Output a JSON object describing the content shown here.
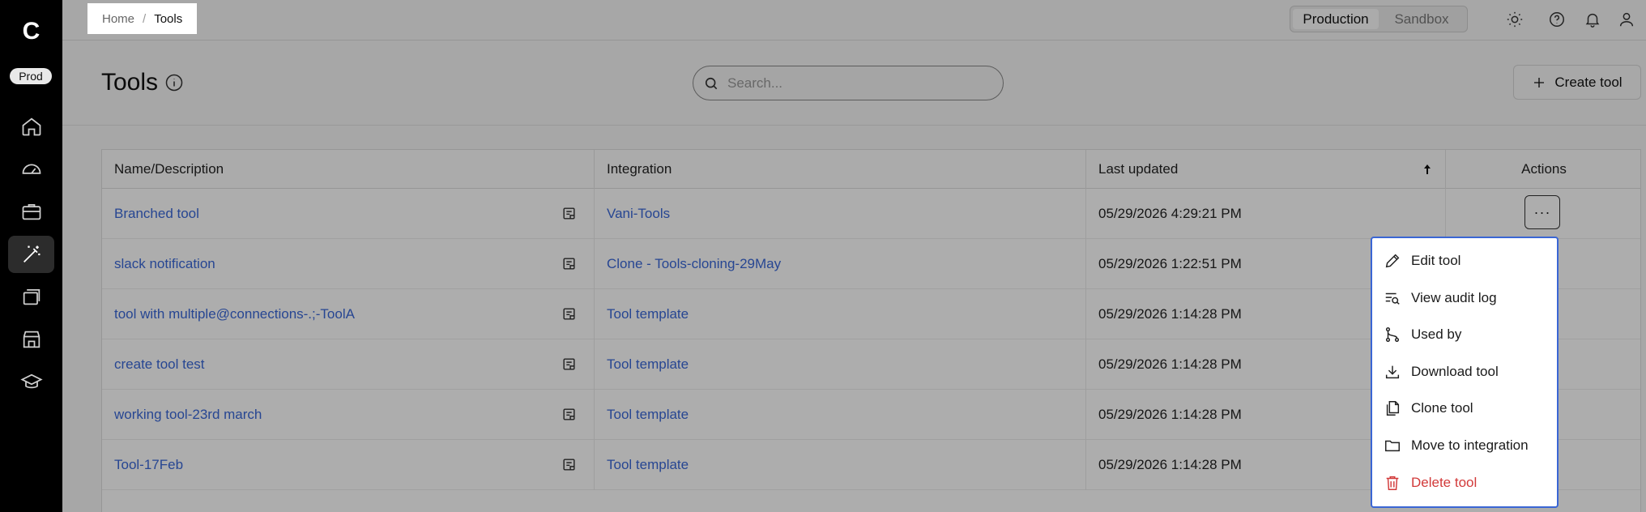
{
  "sidebar": {
    "logo": "C",
    "env_badge": "Prod",
    "items": [
      {
        "icon": "home-icon"
      },
      {
        "icon": "gauge-icon"
      },
      {
        "icon": "briefcase-icon"
      },
      {
        "icon": "magic-wand-icon",
        "active": true
      },
      {
        "icon": "layers-icon"
      },
      {
        "icon": "store-icon"
      },
      {
        "icon": "graduation-cap-icon"
      }
    ]
  },
  "breadcrumb": {
    "home": "Home",
    "separator": "/",
    "current": "Tools"
  },
  "env_toggle": {
    "production": "Production",
    "sandbox": "Sandbox",
    "selected": "Production"
  },
  "header": {
    "title": "Tools",
    "search_placeholder": "Search...",
    "create_label": "Create tool"
  },
  "table": {
    "columns": [
      "Name/Description",
      "Integration",
      "Last updated",
      "Actions"
    ],
    "sort_column": "Last updated",
    "sort_direction": "ascending",
    "rows": [
      {
        "name": "Branched tool",
        "integration": "Vani-Tools",
        "updated": "05/29/2026 4:29:21 PM"
      },
      {
        "name": "slack notification",
        "integration": "Clone - Tools-cloning-29May",
        "updated": "05/29/2026 1:22:51 PM"
      },
      {
        "name": "tool with multiple@connections-.;-ToolA",
        "integration": "Tool template",
        "updated": "05/29/2026 1:14:28 PM"
      },
      {
        "name": "create tool test",
        "integration": "Tool template",
        "updated": "05/29/2026 1:14:28 PM"
      },
      {
        "name": "working tool-23rd march",
        "integration": "Tool template",
        "updated": "05/29/2026 1:14:28 PM"
      },
      {
        "name": "Tool-17Feb",
        "integration": "Tool template",
        "updated": "05/29/2026 1:14:28 PM"
      }
    ],
    "more_label": "···"
  },
  "menu": {
    "items": [
      {
        "label": "Edit tool",
        "icon": "pencil-icon"
      },
      {
        "label": "View audit log",
        "icon": "audit-log-icon"
      },
      {
        "label": "Used by",
        "icon": "git-branch-icon"
      },
      {
        "label": "Download tool",
        "icon": "download-icon"
      },
      {
        "label": "Clone tool",
        "icon": "copy-icon",
        "highlighted": true
      },
      {
        "label": "Move to integration",
        "icon": "folder-icon"
      },
      {
        "label": "Delete tool",
        "icon": "trash-icon",
        "danger": true
      }
    ]
  },
  "colors": {
    "link": "#3a68d8",
    "menu_border": "#3a66d4",
    "danger": "#d23a3a",
    "sidebar_bg": "#000000"
  }
}
